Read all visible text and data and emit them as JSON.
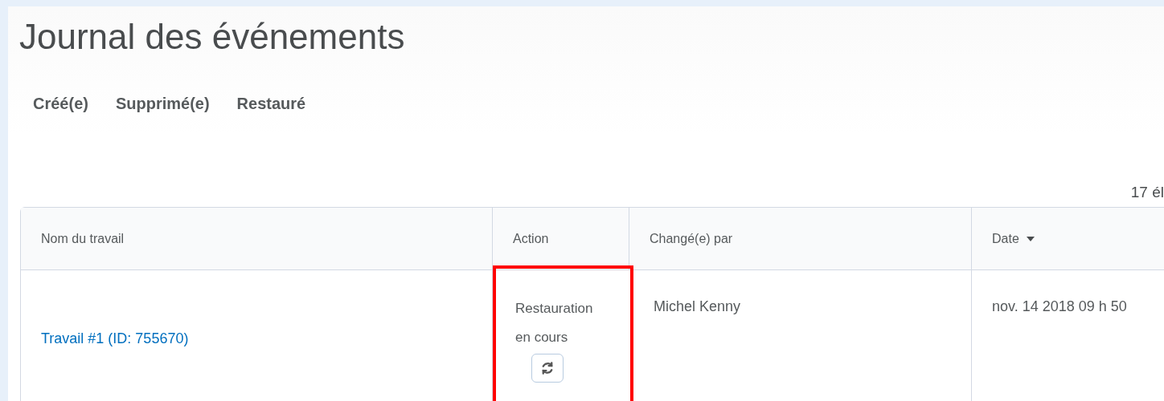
{
  "page": {
    "title": "Journal des événements"
  },
  "tabs": [
    {
      "label": "Créé(e)",
      "selected": false
    },
    {
      "label": "Supprimé(e)",
      "selected": false
    },
    {
      "label": "Restauré",
      "selected": false
    }
  ],
  "item_count": "17 él",
  "table": {
    "columns": [
      {
        "label": "Nom du travail",
        "sorted": false
      },
      {
        "label": "Action",
        "sorted": false
      },
      {
        "label": "Changé(e) par",
        "sorted": false
      },
      {
        "label": "Date",
        "sorted": true
      }
    ],
    "rows": [
      {
        "name": "Travail #1 (ID: 755670)",
        "action": "Restauration en cours",
        "action_highlighted": true,
        "changed_by": "Michel Kenny",
        "date": "nov. 14 2018 09 h 50"
      }
    ]
  }
}
